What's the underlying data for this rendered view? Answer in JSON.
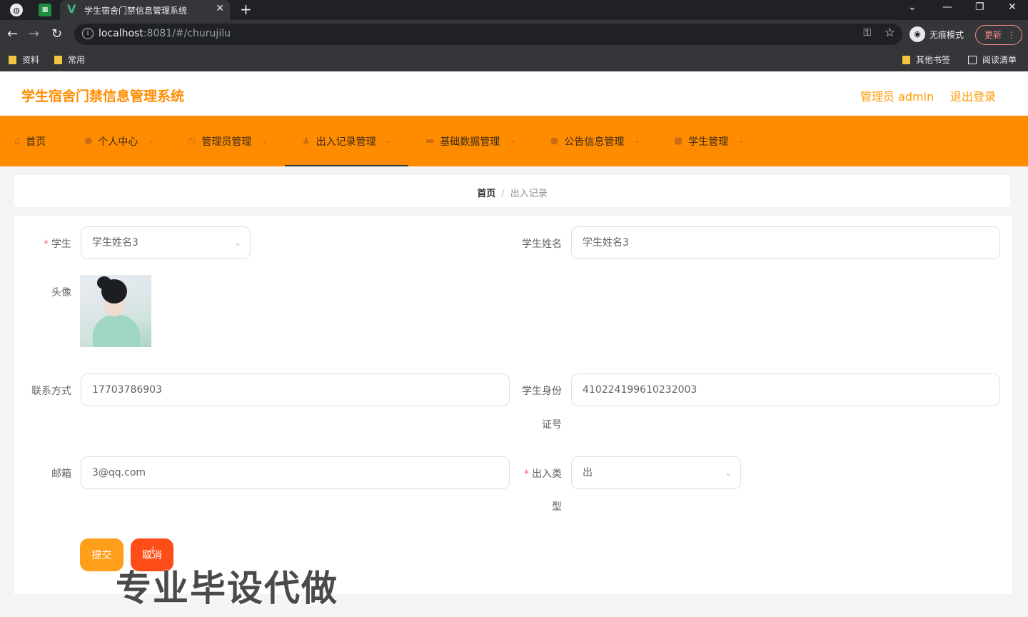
{
  "browser": {
    "tab_title": "学生宿舍门禁信息管理系统",
    "url_host": "localhost",
    "url_rest": ":8081/#/churujilu",
    "incognito_label": "无痕模式",
    "update_label": "更新",
    "bookmarks": [
      "资料",
      "常用"
    ],
    "bookmarks_right": [
      "其他书签",
      "阅读清单"
    ]
  },
  "header": {
    "title": "学生宿舍门禁信息管理系统",
    "user_label": "管理员 admin",
    "logout_label": "退出登录"
  },
  "nav": {
    "items": [
      {
        "label": "首页",
        "icon": "home-icon"
      },
      {
        "label": "个人中心",
        "icon": "user-icon"
      },
      {
        "label": "管理员管理",
        "icon": "clock-icon"
      },
      {
        "label": "出入记录管理",
        "icon": "person-icon",
        "active": true
      },
      {
        "label": "基础数据管理",
        "icon": "chat-icon"
      },
      {
        "label": "公告信息管理",
        "icon": "pin-icon"
      },
      {
        "label": "学生管理",
        "icon": "grid-icon"
      }
    ]
  },
  "breadcrumb": {
    "home": "首页",
    "separator": "/",
    "current": "出入记录"
  },
  "form": {
    "student_label": "学生",
    "student_value": "学生姓名3",
    "student_name_label": "学生姓名",
    "student_name_value": "学生姓名3",
    "avatar_label": "头像",
    "phone_label": "联系方式",
    "phone_value": "17703786903",
    "id_label_line1": "学生身份",
    "id_label_line2": "证号",
    "id_value": "410224199610232003",
    "email_label": "邮箱",
    "email_value": "3@qq.com",
    "type_label_line1": "出入类",
    "type_label_line2": "型",
    "type_value": "出",
    "required_mark": "*",
    "submit_label": "提交",
    "cancel_label": "取消"
  },
  "watermark": "专业毕设代做",
  "colors": {
    "accent": "#ff8c00",
    "header_link": "#ff9900",
    "submit": "#ff9e1b",
    "cancel": "#ff4d1a",
    "required": "#f56c6c"
  }
}
